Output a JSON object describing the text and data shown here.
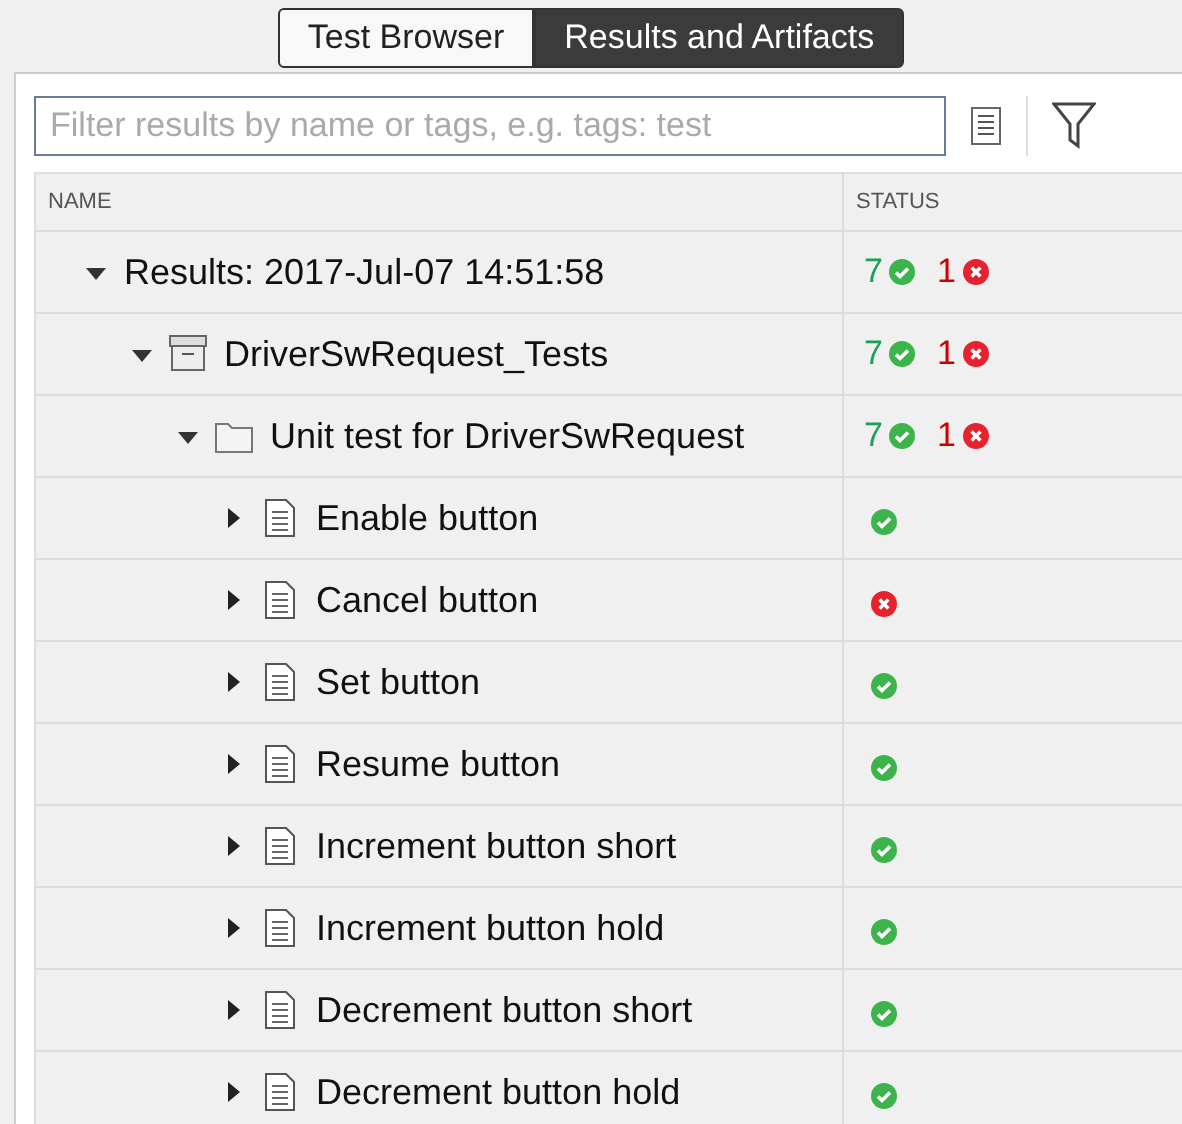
{
  "tabs": [
    {
      "label": "Test Browser",
      "selected": false
    },
    {
      "label": "Results and Artifacts",
      "selected": true
    }
  ],
  "filter": {
    "placeholder": "Filter results by name or tags, e.g. tags: test"
  },
  "table": {
    "columns": [
      "NAME",
      "STATUS"
    ],
    "rows": [
      {
        "kind": "result",
        "label": "Results: 2017-Jul-07 14:51:58",
        "expanded": true,
        "passed": "7",
        "failed": "1",
        "children": [
          {
            "kind": "suite",
            "label": "DriverSwRequest_Tests",
            "expanded": true,
            "passed": "7",
            "failed": "1",
            "children": [
              {
                "kind": "folder",
                "label": "Unit test for DriverSwRequest",
                "expanded": true,
                "passed": "7",
                "failed": "1",
                "children": [
                  {
                    "kind": "test",
                    "label": "Enable button",
                    "expanded": false,
                    "error": false
                  },
                  {
                    "kind": "test",
                    "label": "Cancel button",
                    "expanded": false,
                    "error": true
                  },
                  {
                    "kind": "test",
                    "label": "Set button",
                    "expanded": false,
                    "error": false
                  },
                  {
                    "kind": "test",
                    "label": "Resume button",
                    "expanded": false,
                    "error": false
                  },
                  {
                    "kind": "test",
                    "label": "Increment button short",
                    "expanded": false,
                    "error": false
                  },
                  {
                    "kind": "test",
                    "label": "Increment button hold",
                    "expanded": false,
                    "error": false
                  },
                  {
                    "kind": "test",
                    "label": "Decrement button short",
                    "expanded": false,
                    "error": false
                  },
                  {
                    "kind": "test",
                    "label": "Decrement button hold",
                    "expanded": false,
                    "error": false
                  }
                ]
              }
            ]
          }
        ]
      }
    ]
  }
}
